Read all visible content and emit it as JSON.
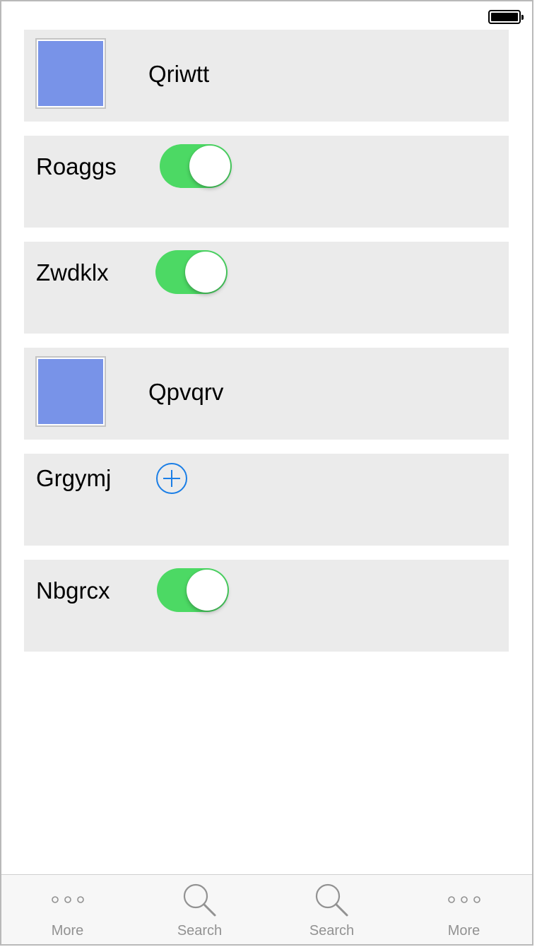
{
  "status_bar": {
    "battery_icon": "battery-full-icon"
  },
  "rows": [
    {
      "type": "image",
      "label": "Qriwtt",
      "image_color": "#7893e8"
    },
    {
      "type": "toggle",
      "label": "Roaggs",
      "on": true
    },
    {
      "type": "toggle",
      "label": "Zwdklx",
      "on": true
    },
    {
      "type": "image",
      "label": "Qpvqrv",
      "image_color": "#7893e8"
    },
    {
      "type": "add",
      "label": "Grgymj",
      "icon": "add-circle-icon"
    },
    {
      "type": "toggle",
      "label": "Nbgrcx",
      "on": true
    }
  ],
  "tab_bar": {
    "tabs": [
      {
        "label": "More",
        "icon": "more-icon"
      },
      {
        "label": "Search",
        "icon": "search-icon"
      },
      {
        "label": "Search",
        "icon": "search-icon"
      },
      {
        "label": "More",
        "icon": "more-icon"
      }
    ]
  },
  "colors": {
    "toggle_on": "#4cd964",
    "add_icon": "#1a7ee6",
    "tab_inactive": "#929292",
    "row_background": "#ebebeb"
  }
}
